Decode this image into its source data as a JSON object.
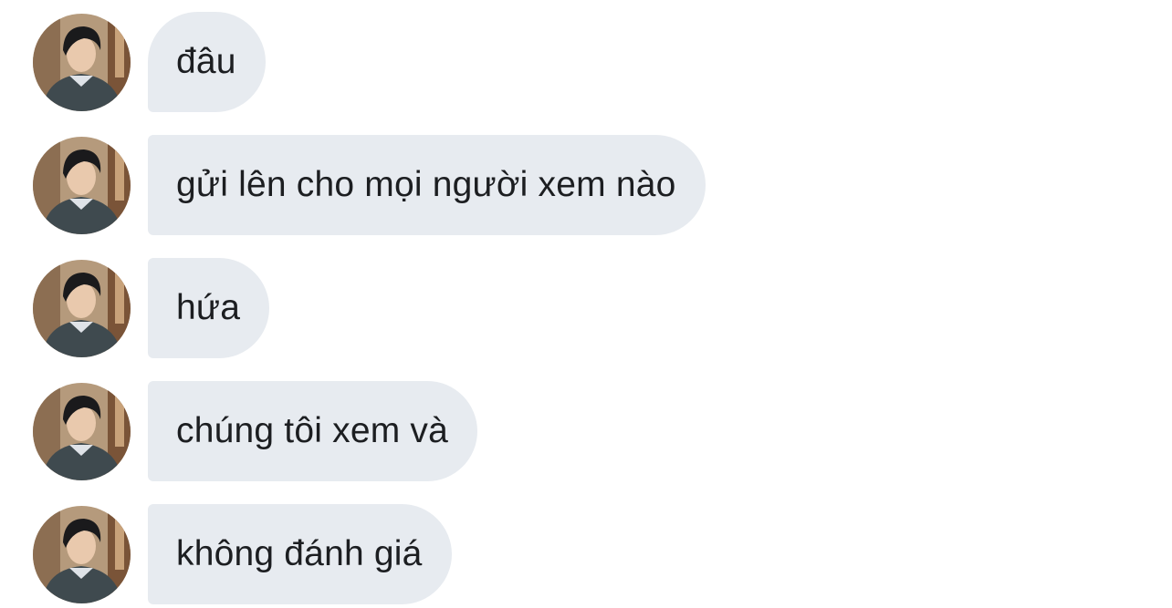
{
  "messages": [
    {
      "text": "đâu"
    },
    {
      "text": "gửi lên cho mọi người xem nào"
    },
    {
      "text": "hứa"
    },
    {
      "text": "chúng tôi xem và"
    },
    {
      "text": "không đánh giá"
    }
  ],
  "colors": {
    "bubble": "#e7ebf0",
    "text": "#1c1e21",
    "background": "#ffffff"
  },
  "icons": {
    "avatar": "avatar-photo"
  }
}
